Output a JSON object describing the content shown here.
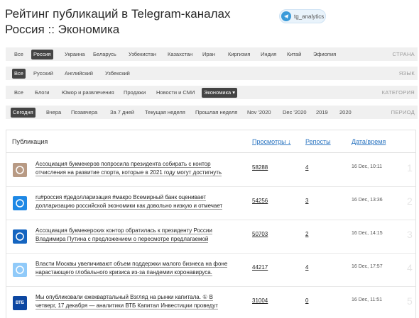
{
  "header": {
    "title_line1": "Рейтинг публикаций в Telegram-каналах",
    "title_line2": "Россия :: Экономика",
    "badge": "tg_analytics"
  },
  "filters": {
    "country": {
      "label": "СТРАНА",
      "items": [
        "Все",
        "Россия",
        "Украина",
        "Беларусь",
        "Узбекистан",
        "Казахстан",
        "Иран",
        "Киргизия",
        "Индия",
        "Китай",
        "Эфиопия"
      ],
      "active": 1
    },
    "language": {
      "label": "ЯЗЫК",
      "items": [
        "Все",
        "Русский",
        "Английский",
        "Узбекский"
      ],
      "active": 0
    },
    "category": {
      "label": "КАТЕГОРИЯ",
      "items": [
        "Все",
        "Блоги",
        "Юмор и развлечения",
        "Продажи",
        "Новости и СМИ",
        "Экономика ▾"
      ],
      "active": 5
    },
    "period": {
      "label": "ПЕРИОД",
      "items": [
        "Сегодня",
        "Вчера",
        "Позавчера",
        "За 7 дней",
        "Текущая неделя",
        "Прошлая неделя",
        "Nov '2020",
        "Dec '2020",
        "2019",
        "2020"
      ],
      "active": 0
    }
  },
  "table": {
    "headers": {
      "publication": "Публикация",
      "views": "Просмотры ↓",
      "reposts": "Репосты",
      "datetime": "Дата/время"
    },
    "rows": [
      {
        "line1": "Ассоциация букмекеров попросила президента собирать с контор",
        "line2": "отчисления на развитие спорта, которые в 2021 году могут достигнуть",
        "views": "58288",
        "reposts": "4",
        "date": "16 Dec, 10:11",
        "rank": "1",
        "avatar": "person-photo-icon",
        "color": "#b89a84"
      },
      {
        "line1": "ru#россия #дедолларизация #макро Всемирный банк оценивает",
        "line2": "долларизацию российской экономики как довольно низкую и отмечает",
        "views": "54256",
        "reposts": "3",
        "date": "16 Dec, 13:36",
        "rank": "2",
        "avatar": "globe-icon",
        "color": "#1e88e5"
      },
      {
        "line1": "Ассоциация букмекерских контор обратилась к президенту России",
        "line2": "Владимира Путина с предложением о пересмотре предлагаемой",
        "views": "50703",
        "reposts": "2",
        "date": "16 Dec, 14:15",
        "rank": "3",
        "avatar": "swirl-logo-icon",
        "color": "#1565c0"
      },
      {
        "line1": "Власти Москвы увеличивают объем поддержки малого бизнеса на фоне",
        "line2": "нарастающего глобального кризиса из-за пандемии коронавируса.",
        "views": "44217",
        "reposts": "4",
        "date": "16 Dec, 17:57",
        "rank": "4",
        "avatar": "cartoon-avatar-icon",
        "color": "#90caf9"
      },
      {
        "line1": "Мы опубликовали ежеквартальный Взгляд на рынки капитала. ①  В",
        "line2": "четверг, 17 декабря — аналитики ВТБ Капитал Инвестиции проведут",
        "views": "31004",
        "reposts": "0",
        "date": "16 Dec, 11:51",
        "rank": "5",
        "avatar": "vtb-logo-icon",
        "color": "#0d47a1",
        "avatar_text": "ВТБ"
      }
    ]
  }
}
